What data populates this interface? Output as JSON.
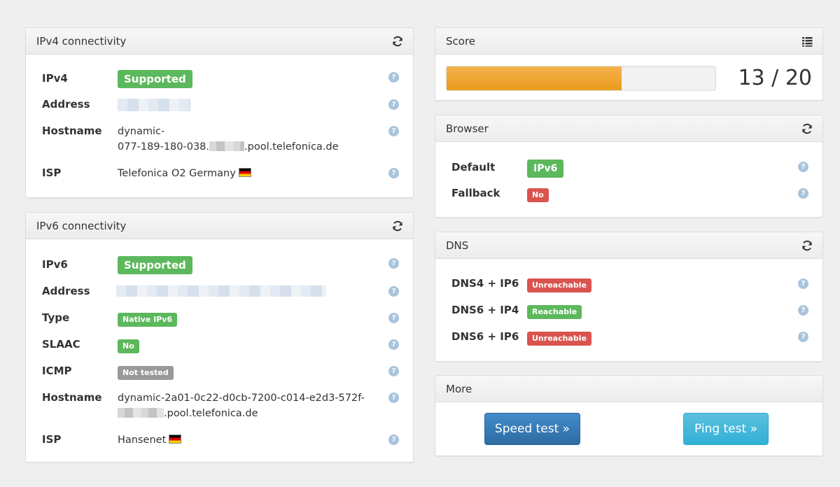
{
  "ipv4": {
    "title": "IPv4 connectivity",
    "rows": [
      {
        "label": "IPv4",
        "badge": "Supported",
        "badge_color": "#5cb85c"
      },
      {
        "label": "Address"
      },
      {
        "label": "Hostname",
        "value_line1": "dynamic-",
        "value_line2_prefix": "077-189-180-038.",
        "value_line2_suffix": ".pool.telefonica.de"
      },
      {
        "label": "ISP",
        "value": "Telefonica O2 Germany"
      }
    ]
  },
  "ipv6": {
    "title": "IPv6 connectivity",
    "rows": [
      {
        "label": "IPv6",
        "badge": "Supported",
        "badge_color": "#5cb85c"
      },
      {
        "label": "Address"
      },
      {
        "label": "Type",
        "badge": "Native IPv6",
        "badge_color": "#5cb85c"
      },
      {
        "label": "SLAAC",
        "badge": "No",
        "badge_color": "#5cb85c"
      },
      {
        "label": "ICMP",
        "badge": "Not tested",
        "badge_color": "#999999"
      },
      {
        "label": "Hostname",
        "value_line1": "dynamic-2a01-0c22-d0cb-7200-c014-e2d3-572f-",
        "value_line2_suffix": ".pool.telefonica.de"
      },
      {
        "label": "ISP",
        "value": "Hansenet"
      }
    ]
  },
  "score": {
    "title": "Score",
    "text": "13 / 20",
    "fraction": 0.65,
    "bar_color": "#eb9a1d"
  },
  "browser": {
    "title": "Browser",
    "rows": [
      {
        "label": "Default",
        "badge": "IPv6",
        "badge_color": "#5cb85c"
      },
      {
        "label": "Fallback",
        "badge": "No",
        "badge_color": "#d9534f"
      }
    ]
  },
  "dns": {
    "title": "DNS",
    "rows": [
      {
        "label": "DNS4 + IP6",
        "badge": "Unreachable",
        "badge_color": "#d9534f"
      },
      {
        "label": "DNS6 + IP4",
        "badge": "Reachable",
        "badge_color": "#5cb85c"
      },
      {
        "label": "DNS6 + IP6",
        "badge": "Unreachable",
        "badge_color": "#d9534f"
      }
    ]
  },
  "more": {
    "title": "More",
    "speed_test": "Speed test »",
    "ping_test": "Ping test »"
  },
  "help_glyph": "?",
  "icons": {
    "refresh": "refresh-icon",
    "list": "list-icon",
    "help": "help-icon",
    "flag": "german-flag-icon"
  }
}
